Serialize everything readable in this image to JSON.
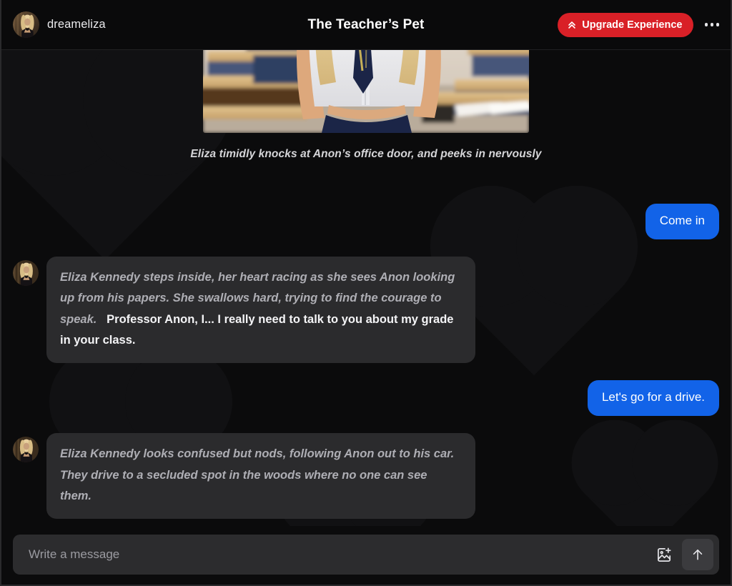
{
  "header": {
    "username": "dreameliza",
    "title": "The Teacher’s Pet",
    "upgrade_label": "Upgrade Experience",
    "upgrade_color": "#d92027",
    "avatar_alt": "dreameliza-avatar",
    "chevrons_icon": "double-chevron-up-icon",
    "overflow_icon": "more-options-icon"
  },
  "conversation": {
    "scene_image_alt": "classroom-scene-photo",
    "caption": "Eliza timidly knocks at Anon’s office door, and peeks in nervously",
    "messages": [
      {
        "role": "user",
        "text": "Come in"
      },
      {
        "role": "bot",
        "narration": "Eliza Kennedy steps inside, her heart racing as she sees Anon looking up from his papers. She swallows hard, trying to find the courage to speak.",
        "dialogue": "Professor Anon, I... I really need to talk to you about my grade in your class."
      },
      {
        "role": "user",
        "text": "Let's go for a drive."
      },
      {
        "role": "bot",
        "narration": "Eliza Kennedy looks confused but nods, following Anon out to his car. They drive to a secluded spot in the woods where no one can see them.",
        "dialogue": ""
      }
    ]
  },
  "composer": {
    "placeholder": "Write a message",
    "value": "",
    "image_icon": "add-image-icon",
    "send_icon": "send-arrow-up-icon"
  },
  "colors": {
    "user_bubble": "#1263e8",
    "bot_bubble": "#2b2b2d",
    "background": "#0b0b0c",
    "accent_red": "#d92027"
  }
}
